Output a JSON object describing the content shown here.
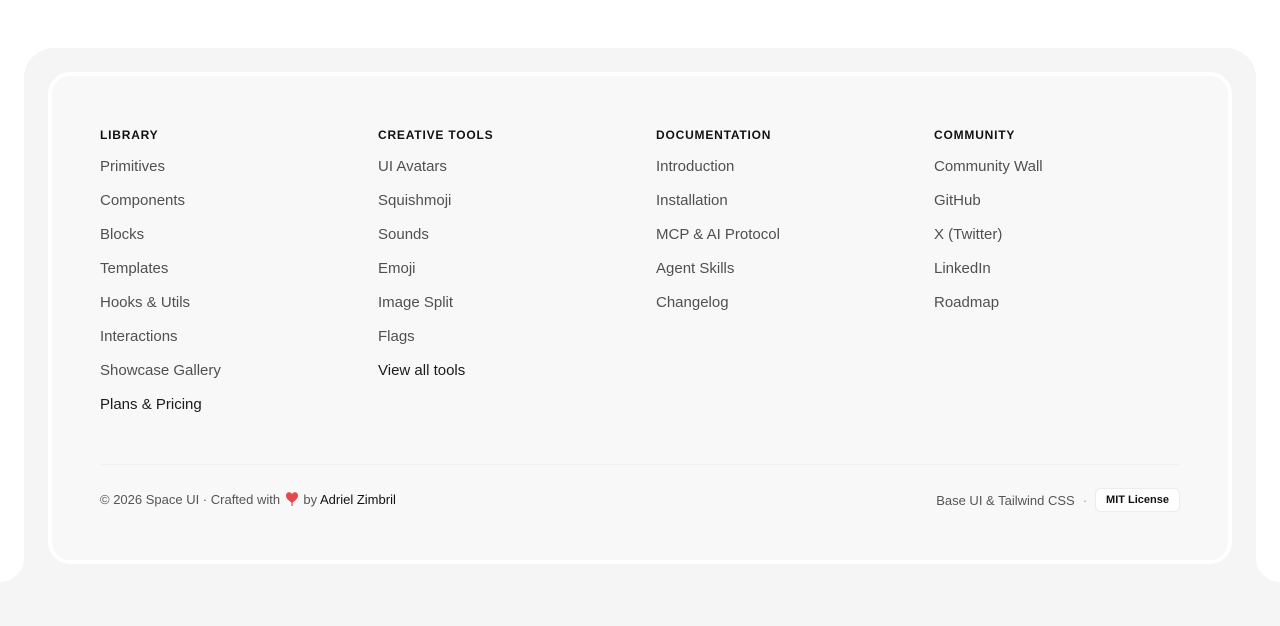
{
  "footer": {
    "columns": [
      {
        "heading": "LIBRARY",
        "links": [
          {
            "label": "Primitives",
            "strong": false
          },
          {
            "label": "Components",
            "strong": false
          },
          {
            "label": "Blocks",
            "strong": false
          },
          {
            "label": "Templates",
            "strong": false
          },
          {
            "label": "Hooks & Utils",
            "strong": false
          },
          {
            "label": "Interactions",
            "strong": false
          },
          {
            "label": "Showcase Gallery",
            "strong": false
          },
          {
            "label": "Plans & Pricing",
            "strong": true
          }
        ]
      },
      {
        "heading": "CREATIVE TOOLS",
        "links": [
          {
            "label": "UI Avatars",
            "strong": false
          },
          {
            "label": "Squishmoji",
            "strong": false
          },
          {
            "label": "Sounds",
            "strong": false
          },
          {
            "label": "Emoji",
            "strong": false
          },
          {
            "label": "Image Split",
            "strong": false
          },
          {
            "label": "Flags",
            "strong": false
          },
          {
            "label": "View all tools",
            "strong": true
          }
        ]
      },
      {
        "heading": "DOCUMENTATION",
        "links": [
          {
            "label": "Introduction",
            "strong": false
          },
          {
            "label": "Installation",
            "strong": false
          },
          {
            "label": "MCP & AI Protocol",
            "strong": false
          },
          {
            "label": "Agent Skills",
            "strong": false
          },
          {
            "label": "Changelog",
            "strong": false
          }
        ]
      },
      {
        "heading": "COMMUNITY",
        "links": [
          {
            "label": "Community Wall",
            "strong": false
          },
          {
            "label": "GitHub",
            "strong": false
          },
          {
            "label": "X (Twitter)",
            "strong": false
          },
          {
            "label": "LinkedIn",
            "strong": false
          },
          {
            "label": "Roadmap",
            "strong": false
          }
        ]
      }
    ],
    "copyright_prefix": "© 2026 Space UI · Crafted with",
    "copyright_by": "by",
    "author": "Adriel Zimbril",
    "heart_icon": "heart-icon",
    "heart_color": "#e5484d",
    "stack_text": "Base UI & Tailwind CSS",
    "separator": "·",
    "license_label": "MIT License"
  }
}
